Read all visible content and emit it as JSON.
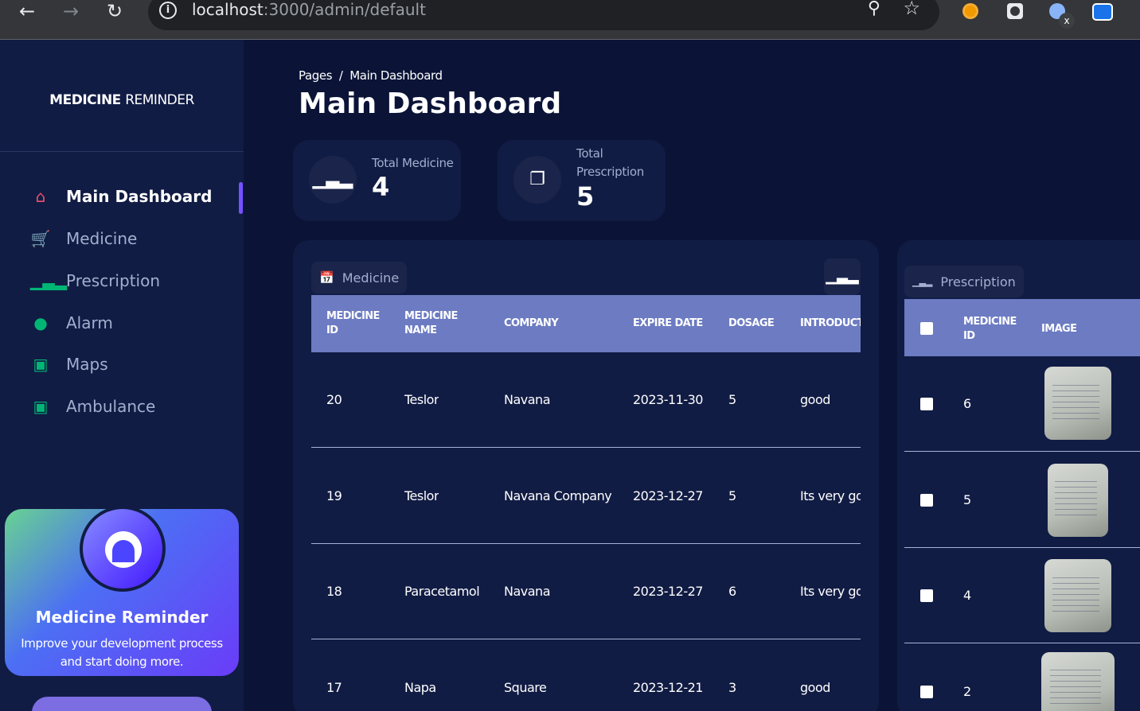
{
  "browser": {
    "url_host": "localhost",
    "url_path": ":3000/admin/default",
    "ext_badge": "x"
  },
  "sidebar": {
    "brand_bold": "MEDICINE",
    "brand_light": "REMINDER",
    "items": [
      {
        "label": "Main Dashboard",
        "icon": "home-icon",
        "active": true
      },
      {
        "label": "Medicine",
        "icon": "cart-icon"
      },
      {
        "label": "Prescription",
        "icon": "bar-chart-icon"
      },
      {
        "label": "Alarm",
        "icon": "person-icon"
      },
      {
        "label": "Maps",
        "icon": "lock-icon"
      },
      {
        "label": "Ambulance",
        "icon": "lock-icon"
      }
    ],
    "promo": {
      "title": "Medicine Reminder",
      "text": "Improve your development process and start doing more."
    }
  },
  "header": {
    "breadcrumb": "Pages  /  Main Dashboard",
    "title": "Main Dashboard"
  },
  "stats": [
    {
      "label": "Total Medicine",
      "value": "4"
    },
    {
      "label": "Total Prescription",
      "value": "5"
    }
  ],
  "medicine_table": {
    "tab_label": "Medicine",
    "columns": [
      "MEDICINE ID",
      "MEDICINE NAME",
      "COMPANY",
      "EXPIRE DATE",
      "DOSAGE",
      "INTRODUCTI"
    ],
    "rows": [
      [
        "20",
        "Teslor",
        "Navana",
        "2023-11-30",
        "5",
        "good"
      ],
      [
        "19",
        "Teslor",
        "Navana Company",
        "2023-12-27",
        "5",
        "Its very goo"
      ],
      [
        "18",
        "Paracetamol",
        "Navana",
        "2023-12-27",
        "6",
        "Its very goo"
      ],
      [
        "17",
        "Napa",
        "Square",
        "2023-12-21",
        "3",
        "good"
      ]
    ]
  },
  "prescription_table": {
    "tab_label": "Prescription",
    "columns": [
      "MEDICINE ID",
      "IMAGE"
    ],
    "rows": [
      {
        "id": "6",
        "image": "prescription-photo"
      },
      {
        "id": "5",
        "image": "prescription-photo"
      },
      {
        "id": "4",
        "image": "prescription-photo"
      },
      {
        "id": "2",
        "image": "prescription-photo"
      }
    ]
  },
  "colors": {
    "bg": "#0b1437",
    "panel": "#111c44",
    "accent": "#7551ff",
    "green": "#01b574",
    "home": "#f0506e",
    "table_header": "#6c7bc2"
  }
}
